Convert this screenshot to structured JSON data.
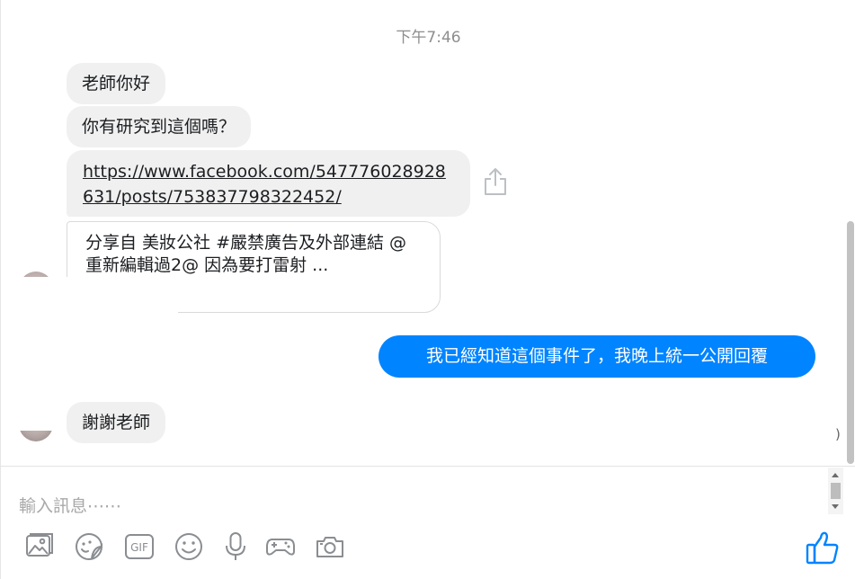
{
  "conversation": {
    "timestamp": "下午7:46",
    "incoming": [
      {
        "text": "老師你好"
      },
      {
        "text": "你有研究到這個嗎？"
      }
    ],
    "link_message": {
      "url": "https://www.facebook.com/547776028928631/posts/753837798322452/"
    },
    "link_preview": {
      "text": "分享自 美妝公社 #嚴禁廣告及外部連結 @重新編輯過2@ 因為要打雷射 ..."
    },
    "outgoing": [
      {
        "text": "我已經知道這個事件了，我晚上統一公開回覆"
      }
    ],
    "incoming_after": [
      {
        "text": "謝謝老師"
      }
    ],
    "partial_char": ")"
  },
  "composer": {
    "placeholder": "輸入訊息⋯⋯",
    "value": "",
    "tools": [
      {
        "name": "photo-icon"
      },
      {
        "name": "sticker-icon"
      },
      {
        "name": "gif-icon",
        "label": "GIF"
      },
      {
        "name": "emoji-icon"
      },
      {
        "name": "microphone-icon"
      },
      {
        "name": "game-controller-icon"
      },
      {
        "name": "camera-icon"
      }
    ],
    "like_icon": "thumbs-up-icon"
  },
  "colors": {
    "accent": "#0084ff",
    "bubble_bg": "#f0f0f0",
    "icon_gray": "#8a8d91"
  }
}
